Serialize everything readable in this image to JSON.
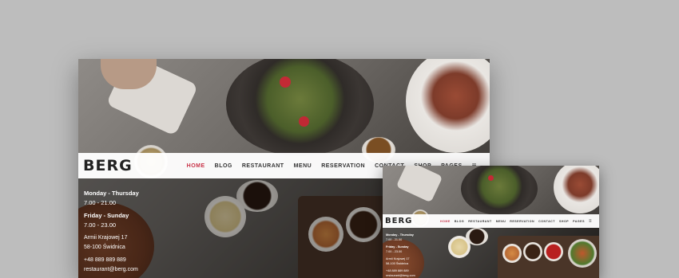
{
  "brand": "BERG",
  "nav": {
    "items": [
      "HOME",
      "BLOG",
      "RESTAURANT",
      "MENU",
      "RESERVATION",
      "CONTACT",
      "SHOP",
      "PAGES"
    ],
    "active_index": 0
  },
  "info": {
    "weekday_label": "Monday - Thursday",
    "weekday_hours": "7.00 - 21.00",
    "weekend_label": "Friday - Sunday",
    "weekend_hours": "7.00 - 23.00",
    "address_line1": "Armii Krajowej 17",
    "address_line2": "58-100 Świdnica",
    "phone": "+48 889 889 889",
    "email": "restaurant@berg.com"
  },
  "icons": {
    "menu": "hamburger-icon"
  },
  "colors": {
    "accent": "#c9354a",
    "background": "#bdbdbd",
    "nav_bg": "#ffffff"
  }
}
